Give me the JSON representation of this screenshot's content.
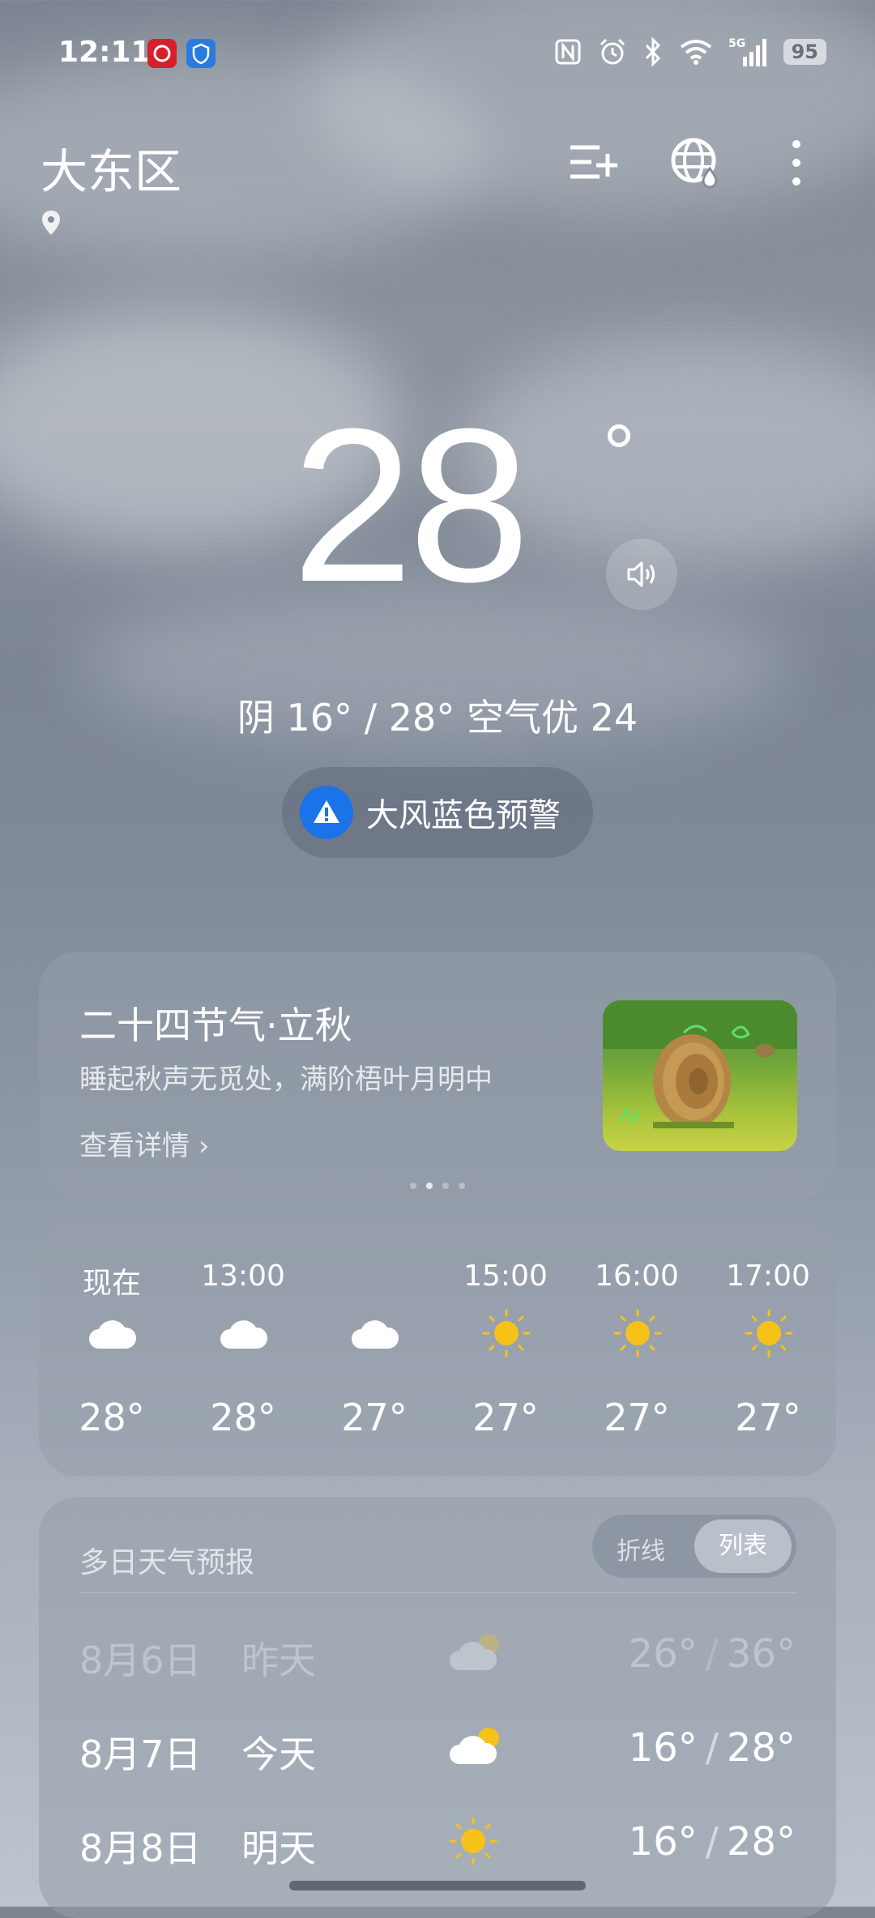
{
  "status": {
    "time": "12:11",
    "battery": "95",
    "network": "5G"
  },
  "header": {
    "city": "大东区"
  },
  "hero": {
    "temperature": "28",
    "degree": "°",
    "summary": "阴  16° / 28°  空气优 24",
    "alert": "大风蓝色预警"
  },
  "solar_term": {
    "title": "二十四节气·立秋",
    "subtitle": "睡起秋声无觅处，满阶梧叶月明中",
    "link": "查看详情",
    "page_count": 4,
    "active_page": 1
  },
  "hourly": [
    {
      "time": "现在",
      "icon": "cloud-icon",
      "temp": "28°"
    },
    {
      "time": "13:00",
      "icon": "cloud-icon",
      "temp": "28°"
    },
    {
      "time": "",
      "icon": "cloud-icon",
      "temp": "27°"
    },
    {
      "time": "15:00",
      "icon": "sun-icon",
      "temp": "27°"
    },
    {
      "time": "16:00",
      "icon": "sun-icon",
      "temp": "27°"
    },
    {
      "time": "17:00",
      "icon": "sun-icon",
      "temp": "27°"
    }
  ],
  "forecast": {
    "title": "多日天气预报",
    "toggle": {
      "option_a": "折线",
      "option_b": "列表",
      "selected": "列表"
    },
    "days": [
      {
        "date": "8月6日",
        "name": "昨天",
        "icon": "cloud-sun-icon",
        "low": "26°",
        "high": "36°"
      },
      {
        "date": "8月7日",
        "name": "今天",
        "icon": "cloud-sun-icon",
        "low": "16°",
        "high": "28°"
      },
      {
        "date": "8月8日",
        "name": "明天",
        "icon": "sun-icon",
        "low": "16°",
        "high": "28°"
      }
    ]
  },
  "colors": {
    "alert_blue": "#1a73e8",
    "sun_yellow": "#f6c21a"
  }
}
